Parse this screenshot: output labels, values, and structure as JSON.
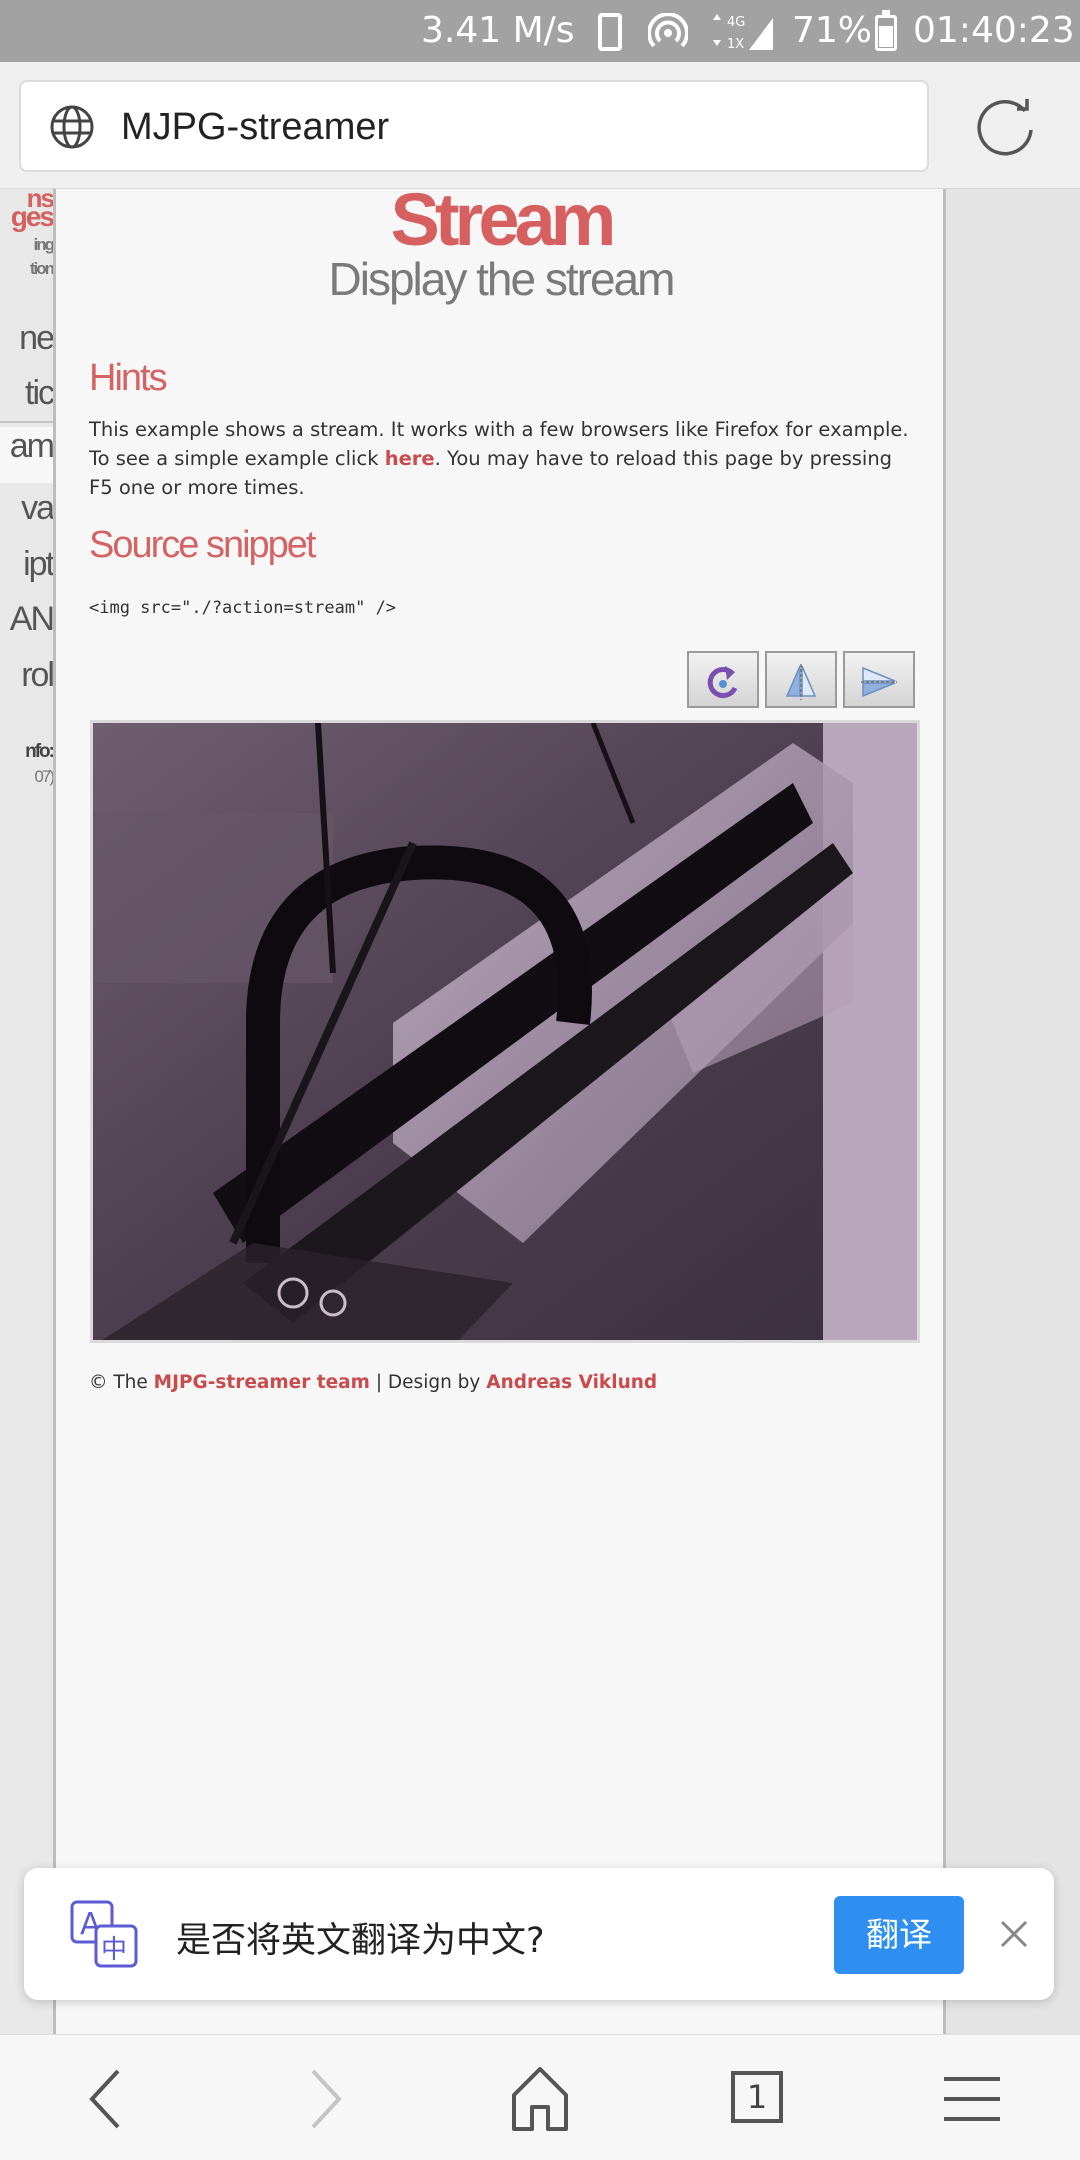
{
  "status_bar": {
    "speed": "3.41 M/s",
    "network_top": "4G",
    "network_bottom": "1X",
    "battery": "71%",
    "time": "01:40:23"
  },
  "url_bar": {
    "title": "MJPG-streamer"
  },
  "sidebar": {
    "items": [
      "ns",
      "ges",
      "ing",
      "tion",
      "ne",
      "tic",
      "am",
      "va",
      "ipt",
      "AN",
      "rol",
      "nfo:",
      "07)"
    ]
  },
  "page": {
    "title": "Stream",
    "subtitle": "Display the stream",
    "hints_heading": "Hints",
    "hints_text_1": "This example shows a stream. It works with a few browsers like Firefox for example. To see a simple example click ",
    "hints_link": "here",
    "hints_text_2": ". You may have to reload this page by pressing F5 one or more times.",
    "snippet_heading": "Source snippet",
    "code": "<img src=\"./?action=stream\" />",
    "footer_prefix": "© The ",
    "footer_team": "MJPG-streamer team",
    "footer_mid": " | Design by ",
    "footer_designer": "Andreas Viklund"
  },
  "toolbar": {
    "icons": [
      "rotate-icon",
      "flip-icon",
      "mirror-icon"
    ]
  },
  "translate_bar": {
    "prompt": "是否将英文翻译为中文?",
    "button": "翻译"
  },
  "bottom_nav": {
    "tab_count": "1"
  },
  "colors": {
    "accent_red": "#d65f5f",
    "translate_blue": "#2e8ff0",
    "status_bar": "#a2a2a2"
  }
}
